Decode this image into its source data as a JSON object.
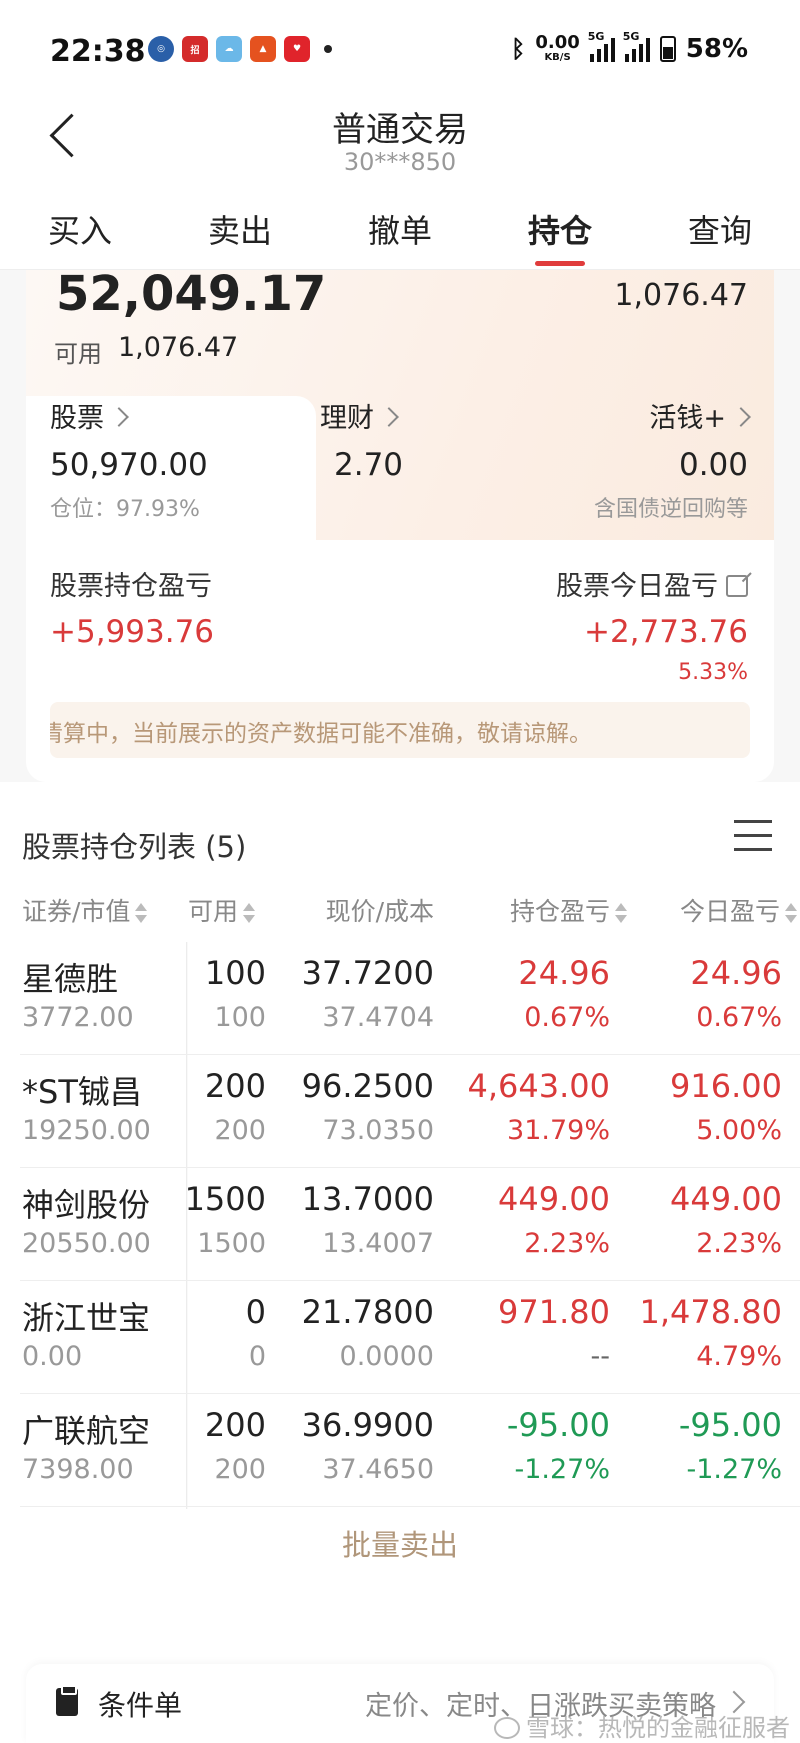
{
  "status_bar": {
    "time": "22:38",
    "net_speed_value": "0.00",
    "net_speed_unit": "KB/S",
    "signal1_tag": "5G",
    "signal2_tag": "5G",
    "battery": "58%"
  },
  "header": {
    "title": "普通交易",
    "account": "30***850"
  },
  "tabs": [
    {
      "label": "买入"
    },
    {
      "label": "卖出"
    },
    {
      "label": "撤单"
    },
    {
      "label": "持仓"
    },
    {
      "label": "查询"
    }
  ],
  "active_tab": "持仓",
  "assets": {
    "total": "52,049.17",
    "right_amount": "1,076.47",
    "available_label": "可用",
    "available_value": "1,076.47",
    "stocks": {
      "label": "股票",
      "value": "50,970.00",
      "note": "仓位：97.93%"
    },
    "wealth": {
      "label": "理财",
      "value": "2.70"
    },
    "cash_plus": {
      "label": "活钱+",
      "value": "0.00",
      "note": "含国债逆回购等"
    },
    "holding_pl": {
      "label": "股票持仓盈亏",
      "value": "+5,993.76"
    },
    "today_pl": {
      "label": "股票今日盈亏",
      "value": "+2,773.76",
      "pct": "5.33%"
    },
    "notice": "清算中，当前展示的资产数据可能不准确，敬请谅解。"
  },
  "holdings": {
    "title": "股票持仓列表 (5)",
    "columns": {
      "name": "证券/市值",
      "avail": "可用",
      "price": "现价/成本",
      "pl": "持仓盈亏",
      "today": "今日盈亏"
    },
    "rows": [
      {
        "name": "星德胜",
        "market_value": "3772.00",
        "qty": "100",
        "available": "100",
        "price": "37.7200",
        "cost": "37.4704",
        "pl": "24.96",
        "pl_pct": "0.67%",
        "today_pl": "24.96",
        "today_pct": "0.67%"
      },
      {
        "name": "*ST铖昌",
        "market_value": "19250.00",
        "qty": "200",
        "available": "200",
        "price": "96.2500",
        "cost": "73.0350",
        "pl": "4,643.00",
        "pl_pct": "31.79%",
        "today_pl": "916.00",
        "today_pct": "5.00%"
      },
      {
        "name": "神剑股份",
        "market_value": "20550.00",
        "qty": "1500",
        "available": "1500",
        "price": "13.7000",
        "cost": "13.4007",
        "pl": "449.00",
        "pl_pct": "2.23%",
        "today_pl": "449.00",
        "today_pct": "2.23%"
      },
      {
        "name": "浙江世宝",
        "market_value": "0.00",
        "qty": "0",
        "available": "0",
        "price": "21.7800",
        "cost": "0.0000",
        "pl": "971.80",
        "pl_pct": "--",
        "today_pl": "1,478.80",
        "today_pct": "4.79%"
      },
      {
        "name": "广联航空",
        "market_value": "7398.00",
        "qty": "200",
        "available": "200",
        "price": "36.9900",
        "cost": "37.4650",
        "pl": "-95.00",
        "pl_pct": "-1.27%",
        "today_pl": "-95.00",
        "today_pct": "-1.27%"
      }
    ],
    "batch_sell": "批量卖出"
  },
  "conditional_order": {
    "label": "条件单",
    "description": "定价、定时、日涨跌买卖策略"
  },
  "watermark": "雪球：热悦的金融征服者",
  "colors": {
    "up": "#d93a3a",
    "down": "#1f9a55",
    "accent": "#e03c3c",
    "gold": "#b0967a"
  }
}
